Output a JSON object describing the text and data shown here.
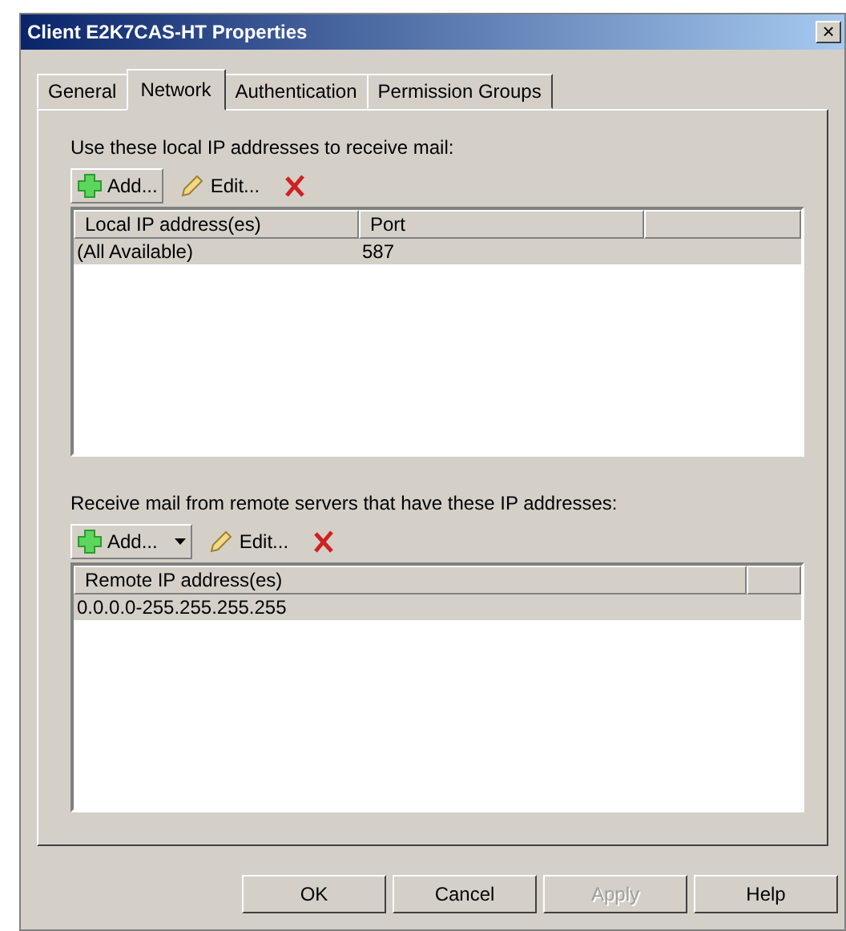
{
  "window": {
    "title": "Client E2K7CAS-HT Properties",
    "close": "×"
  },
  "tabs": [
    {
      "label": "General",
      "selected": false
    },
    {
      "label": "Network",
      "selected": true
    },
    {
      "label": "Authentication",
      "selected": false
    },
    {
      "label": "Permission Groups",
      "selected": false
    }
  ],
  "sections": [
    {
      "label": "Use these local IP addresses to receive mail:",
      "add": "Add...",
      "add_dropdown": false,
      "edit": "Edit...",
      "columns": [
        "Local IP address(es)",
        "Port"
      ],
      "rows": [
        {
          "cells": [
            "(All Available)",
            "587"
          ],
          "selected": true
        }
      ]
    },
    {
      "label": "Receive mail from remote servers that have these IP addresses:",
      "add": "Add...",
      "add_dropdown": true,
      "edit": "Edit...",
      "columns": [
        "Remote IP address(es)"
      ],
      "rows": [
        {
          "cells": [
            "0.0.0.0-255.255.255.255"
          ],
          "selected": true
        }
      ]
    }
  ],
  "buttons": [
    {
      "label": "OK",
      "disabled": false
    },
    {
      "label": "Cancel",
      "disabled": false
    },
    {
      "label": "Apply",
      "disabled": true
    },
    {
      "label": "Help",
      "disabled": false
    }
  ]
}
